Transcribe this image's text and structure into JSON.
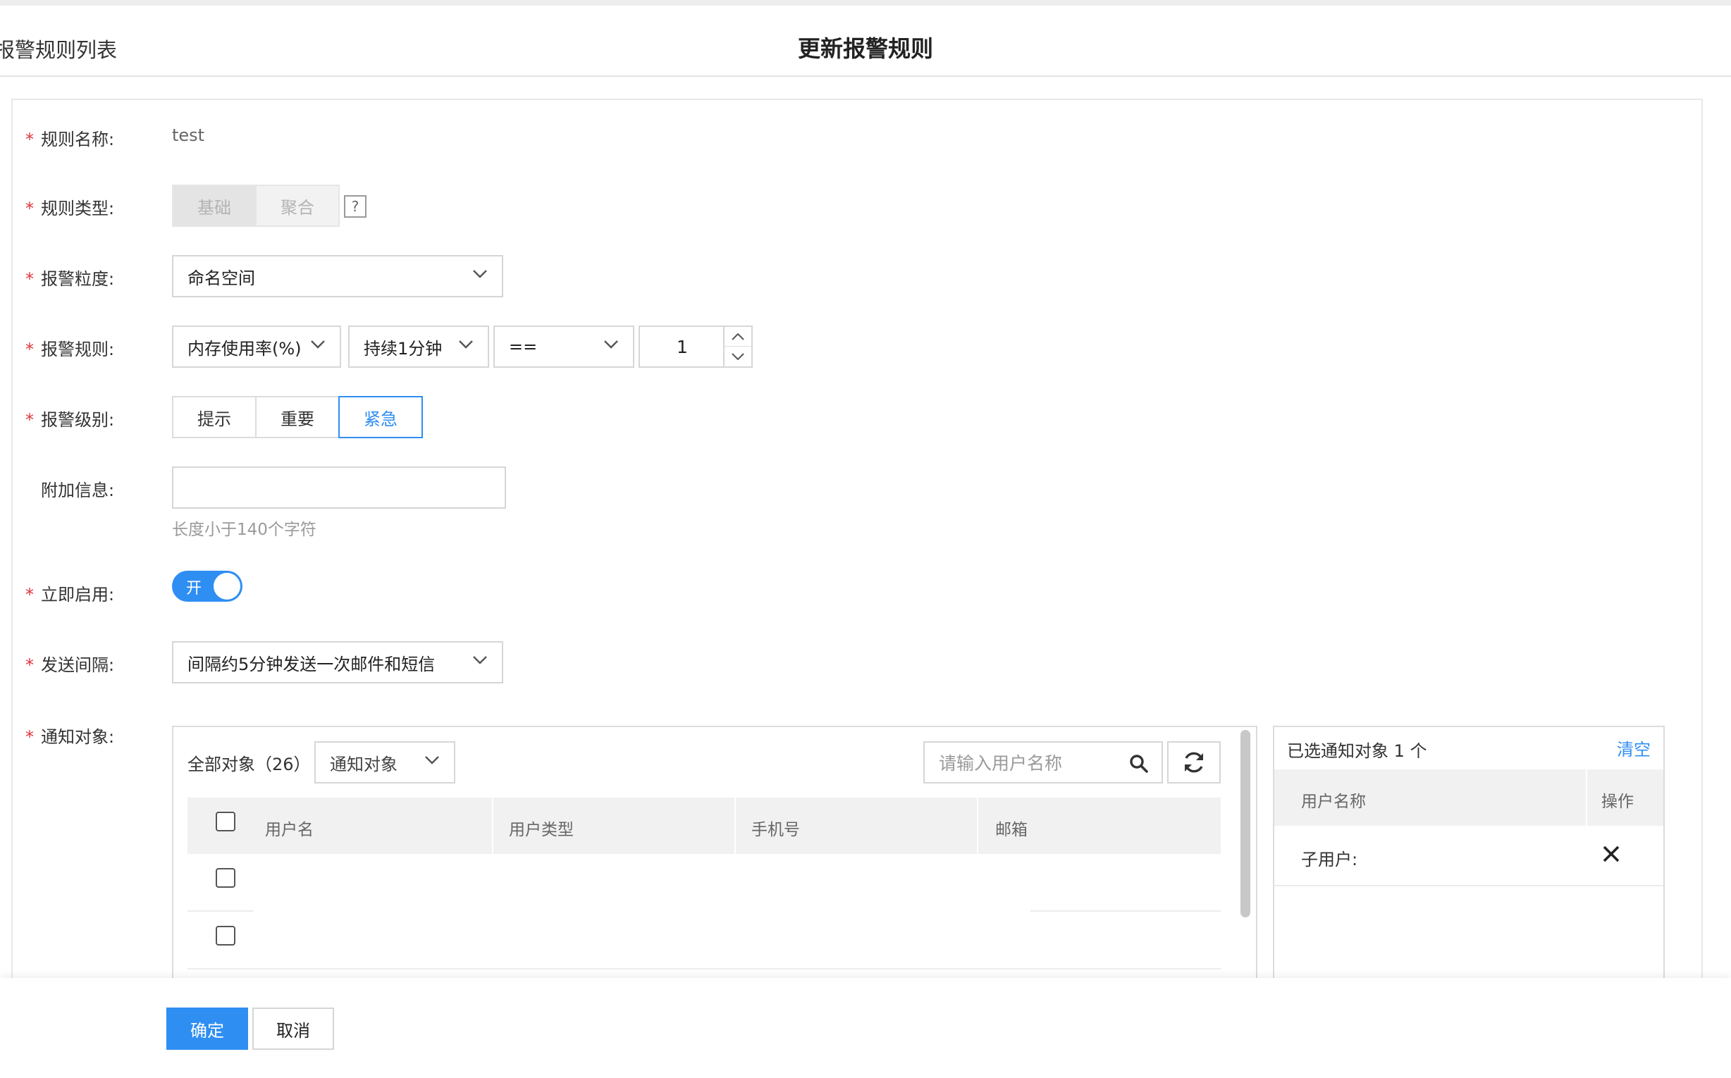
{
  "header": {
    "back_label": "报警规则列表",
    "title": "更新报警规则"
  },
  "form": {
    "rule_name": {
      "label": "规则名称:",
      "value": "test"
    },
    "rule_type": {
      "label": "规则类型:",
      "options": [
        "基础",
        "聚合"
      ],
      "selected": "基础",
      "help": "?"
    },
    "granularity": {
      "label": "报警粒度:",
      "value": "命名空间"
    },
    "rule": {
      "label": "报警规则:",
      "metric": "内存使用率(%)",
      "duration": "持续1分钟",
      "operator": "==",
      "threshold": "1"
    },
    "level": {
      "label": "报警级别:",
      "options": [
        "提示",
        "重要",
        "紧急"
      ],
      "selected": "紧急"
    },
    "extra": {
      "label": "附加信息:",
      "value": "",
      "hint": "长度小于140个字符"
    },
    "enable": {
      "label": "立即启用:",
      "toggle_text": "开",
      "on": true
    },
    "interval": {
      "label": "发送间隔:",
      "value": "间隔约5分钟发送一次邮件和短信"
    },
    "notify": {
      "label": "通知对象:"
    }
  },
  "notify_panel": {
    "all_label": "全部对象（26）",
    "filter_value": "通知对象",
    "search_placeholder": "请输入用户名称",
    "columns": [
      "用户名",
      "用户类型",
      "手机号",
      "邮箱"
    ],
    "rows": [
      {
        "checked": false
      },
      {
        "checked": false
      }
    ]
  },
  "selected_panel": {
    "title": "已选通知对象 1 个",
    "clear_label": "清空",
    "columns": [
      "用户名称",
      "操作"
    ],
    "items": [
      {
        "label": "子用户:"
      }
    ]
  },
  "footer": {
    "confirm_label": "确定",
    "cancel_label": "取消"
  },
  "colors": {
    "accent": "#2f8ef2",
    "required": "#e0373d"
  }
}
